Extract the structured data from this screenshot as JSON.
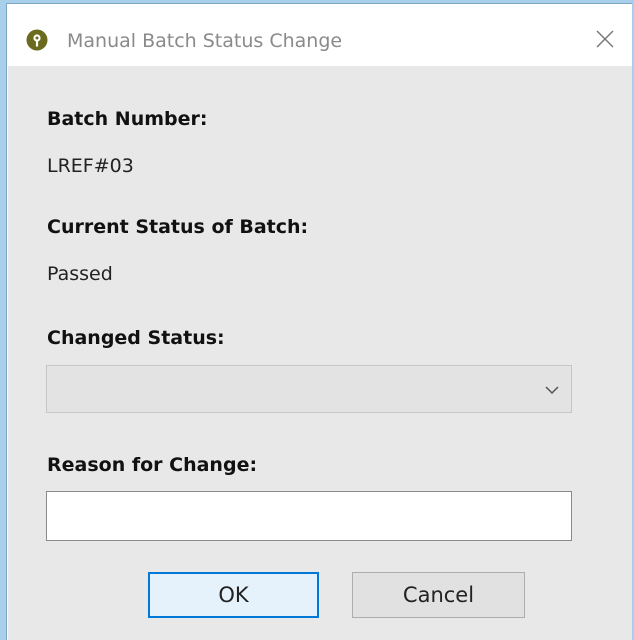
{
  "window": {
    "title": "Manual Batch Status Change"
  },
  "icons": {
    "app": "help-icon",
    "close": "close-icon",
    "dropdown": "chevron-down-icon"
  },
  "fields": {
    "batch_number_label": "Batch Number:",
    "batch_number_value": "LREF#03",
    "current_status_label": "Current Status of Batch:",
    "current_status_value": "Passed",
    "changed_status_label": "Changed Status:",
    "changed_status_value": "",
    "reason_label": "Reason for Change:",
    "reason_value": ""
  },
  "buttons": {
    "ok": "OK",
    "cancel": "Cancel"
  },
  "colors": {
    "app_icon": "#6b6b1f",
    "focus_border": "#0078d7",
    "desktop_edge": "#a9d0ea"
  }
}
